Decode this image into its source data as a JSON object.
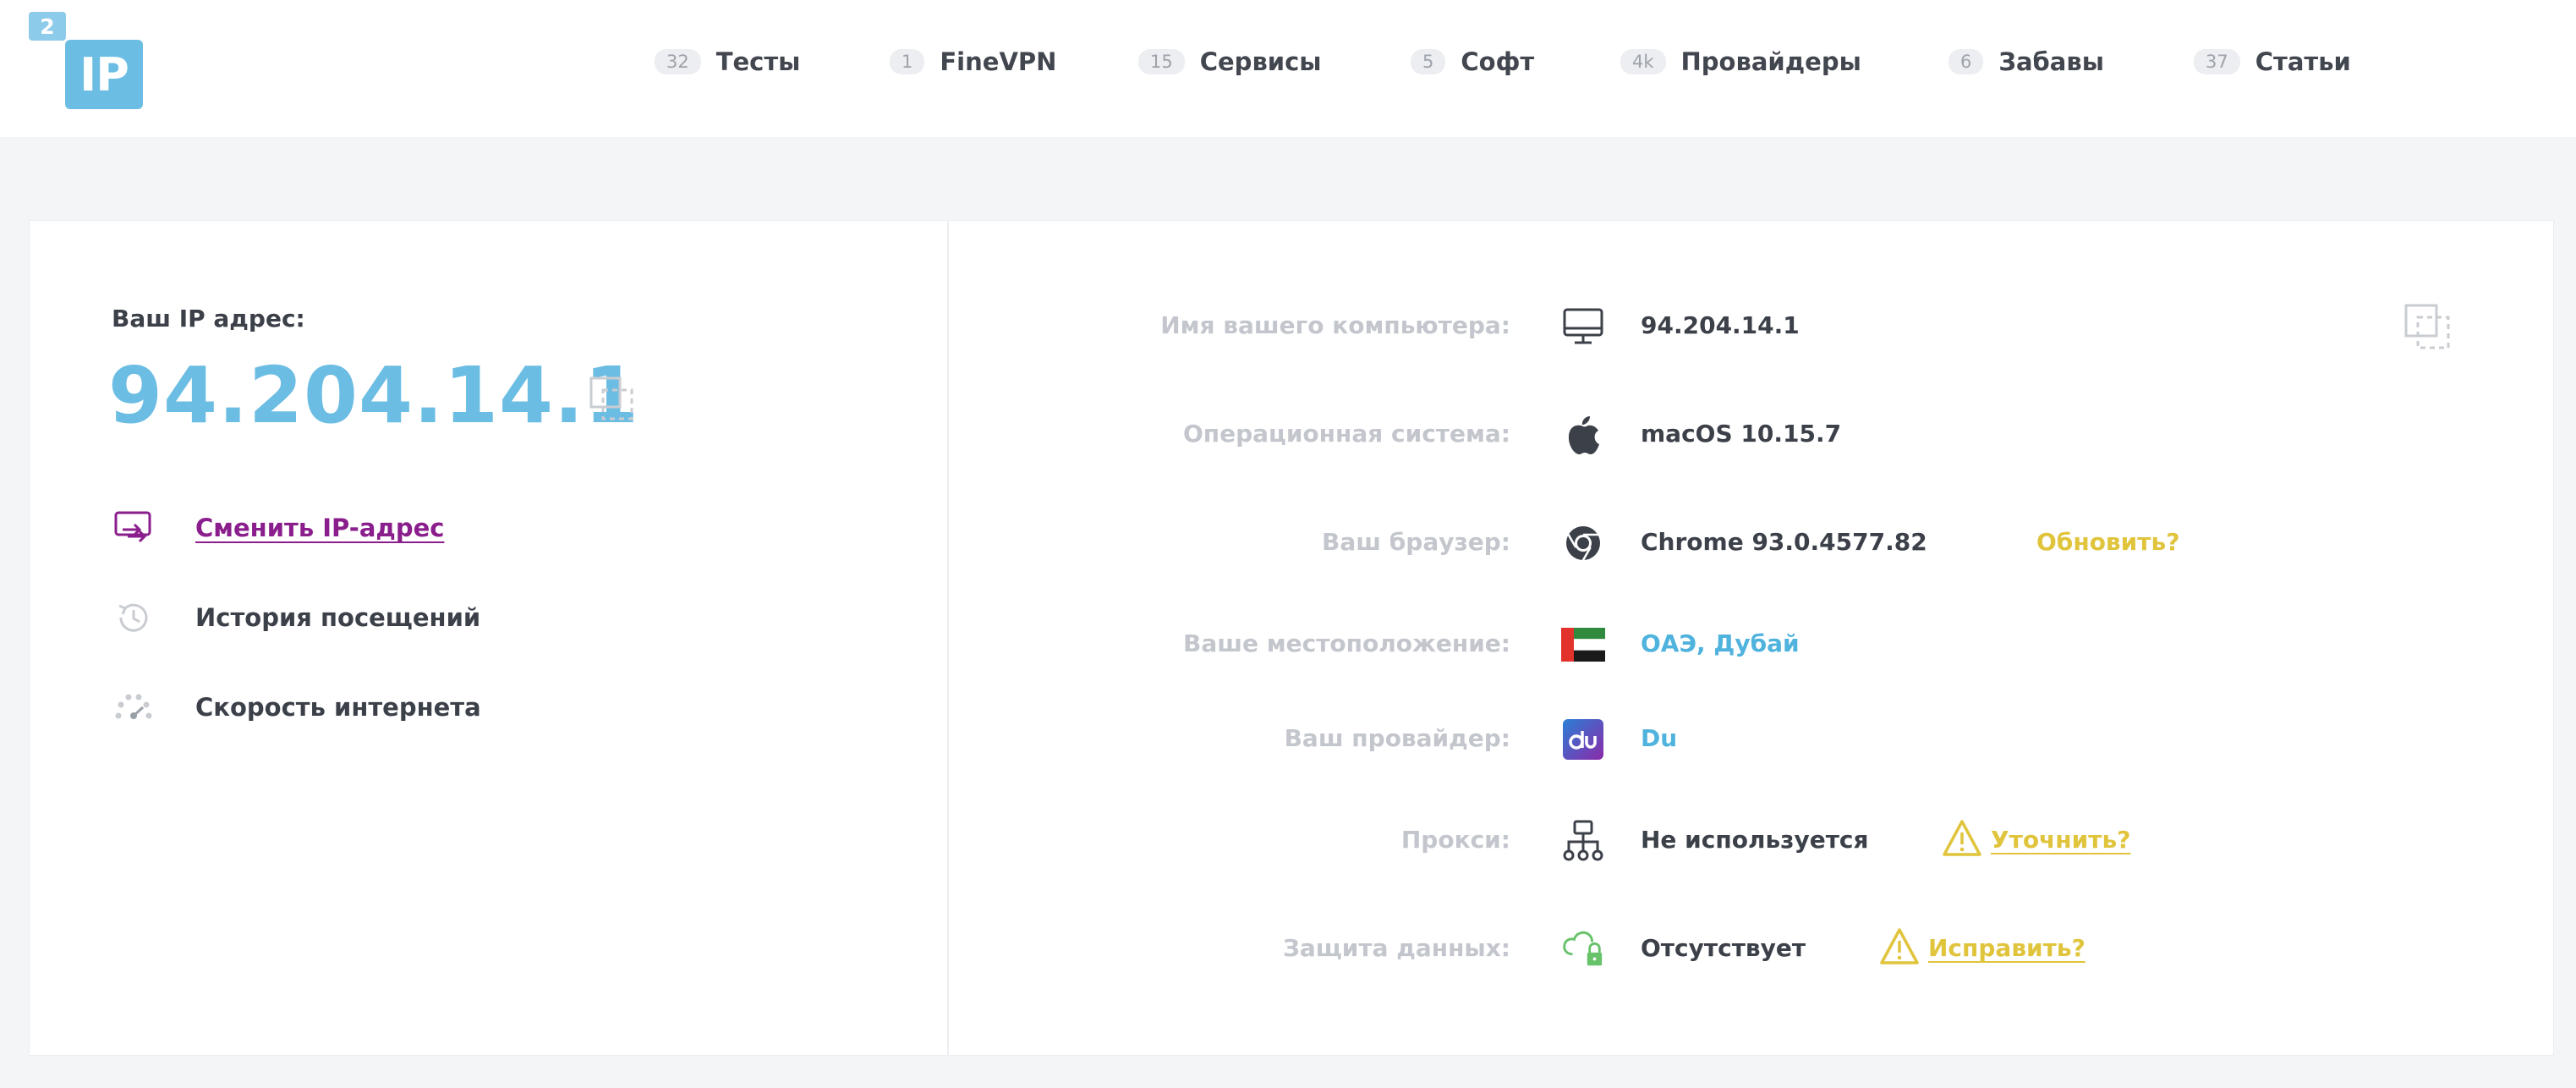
{
  "logo": {
    "superscript": "2",
    "text": "IP"
  },
  "nav": [
    {
      "count": "32",
      "label": "Тесты"
    },
    {
      "count": "1",
      "label": "FineVPN"
    },
    {
      "count": "15",
      "label": "Сервисы"
    },
    {
      "count": "5",
      "label": "Софт"
    },
    {
      "count": "4k",
      "label": "Провайдеры"
    },
    {
      "count": "6",
      "label": "Забавы"
    },
    {
      "count": "37",
      "label": "Статьи"
    }
  ],
  "left": {
    "ip_label": "Ваш IP адрес:",
    "ip_value": "94.204.14.1",
    "actions": [
      {
        "label": "Сменить IP-адрес",
        "icon": "switch-ip-icon"
      },
      {
        "label": "История посещений",
        "icon": "history-icon"
      },
      {
        "label": "Скорость интернета",
        "icon": "speedometer-icon"
      }
    ]
  },
  "info": {
    "computer": {
      "label": "Имя вашего компьютера:",
      "value": "94.204.14.1",
      "icon": "monitor-icon"
    },
    "os": {
      "label": "Операционная система:",
      "value": "macOS 10.15.7",
      "icon": "apple-icon"
    },
    "browser": {
      "label": "Ваш браузер:",
      "value": "Chrome 93.0.4577.82",
      "action": "Обновить?",
      "icon": "chrome-icon"
    },
    "location": {
      "label": "Ваше местоположение:",
      "value": "ОАЭ, Дубай",
      "icon": "uae-flag-icon"
    },
    "provider": {
      "label": "Ваш провайдер:",
      "value": "Du",
      "icon": "du-logo-icon"
    },
    "proxy": {
      "label": "Прокси:",
      "value": "Не используется",
      "action": "Уточнить?",
      "icon": "network-icon"
    },
    "protection": {
      "label": "Защита данных:",
      "value": "Отсутствует",
      "action": "Исправить?",
      "icon": "cloud-lock-icon"
    }
  },
  "colors": {
    "accent_blue": "#6bbde3",
    "link_purple": "#8a1e8c",
    "warning_yellow": "#e0c43c",
    "label_gray": "#c3c6cc"
  }
}
